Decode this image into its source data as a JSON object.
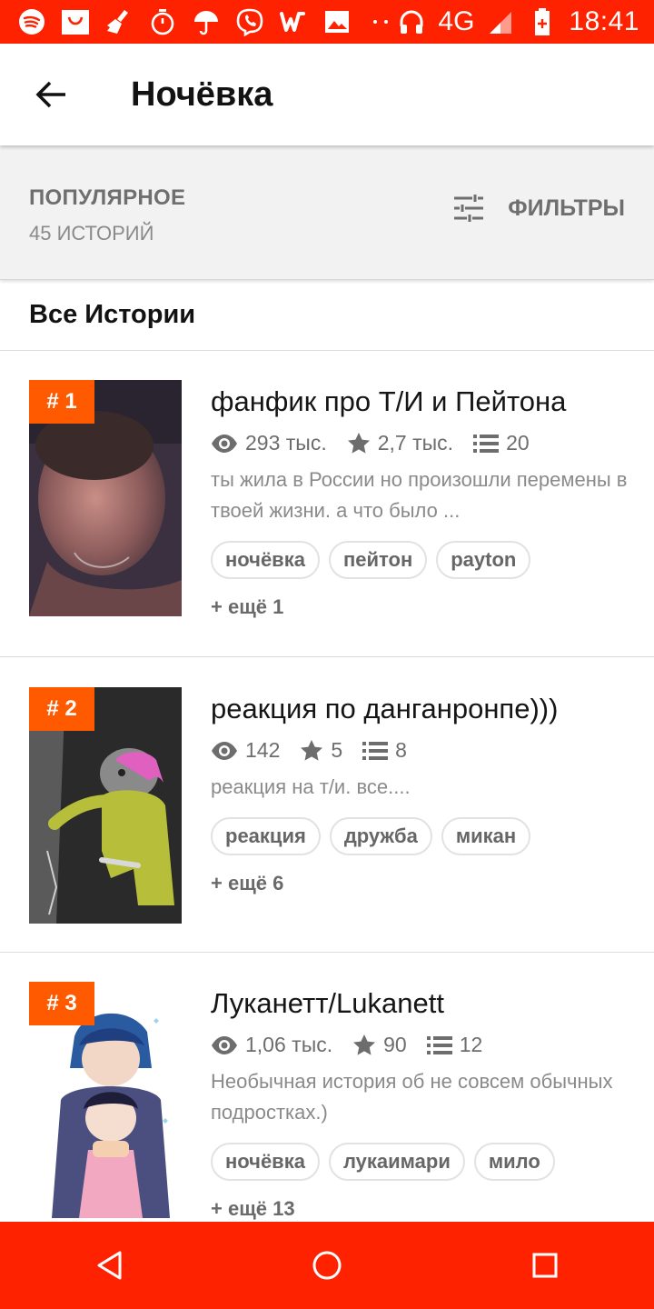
{
  "status_bar": {
    "icons": [
      "spotify-icon",
      "shopping-bag-icon",
      "broom-icon",
      "timer-icon",
      "umbrella-icon",
      "viber-icon",
      "wattpad-icon",
      "image-icon",
      "dots-icon",
      "headphones-icon"
    ],
    "network": "4G",
    "time": "18:41"
  },
  "app_bar": {
    "title": "Ночёвка"
  },
  "sort_bar": {
    "sort_label": "ПОПУЛЯРНОЕ",
    "count": "45 ИСТОРИЙ",
    "filter_label": "ФИЛЬТРЫ"
  },
  "section": {
    "title": "Все Истории"
  },
  "stories": [
    {
      "rank": "# 1",
      "title": "фанфик про Т/И и Пейтона",
      "views": "293 тыс.",
      "votes": "2,7 тыс.",
      "parts": "20",
      "description": "ты жила в России но произошли перемены в твоей жизни. а что было ...",
      "tags": [
        "ночёвка",
        "пейтон",
        "payton"
      ],
      "more": "+ ещё 1"
    },
    {
      "rank": "# 2",
      "title": "реакция по данганронпе)))",
      "views": "142",
      "votes": "5",
      "parts": "8",
      "description": "реакция на т/и. все....",
      "tags": [
        "реакция",
        "дружба",
        "микан"
      ],
      "more": "+ ещё 6"
    },
    {
      "rank": "# 3",
      "title": "Луканетт/Lukanett",
      "views": "1,06 тыс.",
      "votes": "90",
      "parts": "12",
      "description": "Необычная история об не совсем обычных подростках.)",
      "tags": [
        "ночёвка",
        "лукаимари",
        "мило"
      ],
      "more": "+ ещё 13"
    }
  ],
  "colors": {
    "status_bar": "#ff2200",
    "accent": "#ff5a00",
    "nav_bar": "#ff2200"
  }
}
